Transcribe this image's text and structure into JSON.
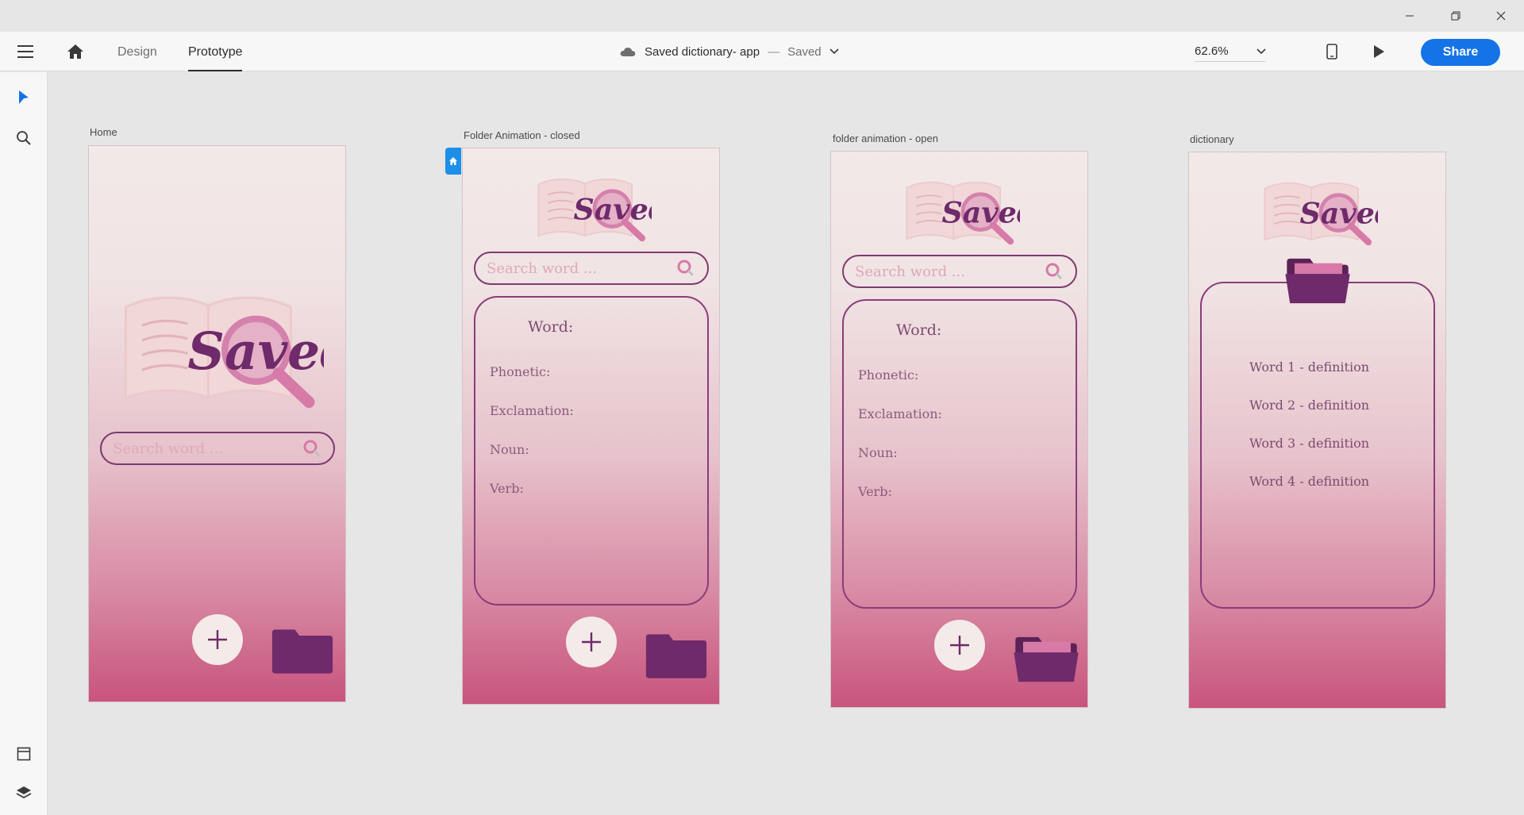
{
  "window": {
    "controls": [
      "minimize-icon",
      "restore-icon",
      "close-icon"
    ]
  },
  "toolbar": {
    "tabs": [
      {
        "label": "Design",
        "active": false
      },
      {
        "label": "Prototype",
        "active": true
      }
    ],
    "doc_name": "Saved dictionary- app",
    "separator": "—",
    "doc_status": "Saved",
    "zoom": "62.6%",
    "share_label": "Share",
    "accent": "#1473e6"
  },
  "rail": {
    "top_tools": [
      "select-arrow-icon",
      "search-icon"
    ],
    "bottom_tools": [
      "artboard-panel-icon",
      "layers-icon"
    ]
  },
  "artboards": {
    "home": {
      "name": "Home",
      "search_placeholder": "Search word ..."
    },
    "closed": {
      "name": "Folder Animation - closed",
      "search_placeholder": "Search word ...",
      "word_label": "Word:",
      "fields": [
        "Phonetic:",
        "Exclamation:",
        "Noun:",
        "Verb:"
      ]
    },
    "open": {
      "name": "folder animation - open",
      "search_placeholder": "Search word ...",
      "word_label": "Word:",
      "fields": [
        "Phonetic:",
        "Exclamation:",
        "Noun:",
        "Verb:"
      ]
    },
    "dictionary": {
      "name": "dictionary",
      "entries": [
        "Word 1 - definition",
        "Word 2 - definition",
        "Word 3 - definition",
        "Word 4 - definition"
      ]
    },
    "brand_text": "Saved",
    "colors": {
      "plum": "#6e2a6a",
      "pink": "#d77aa8",
      "rose_bottom": "#c8547d"
    }
  }
}
